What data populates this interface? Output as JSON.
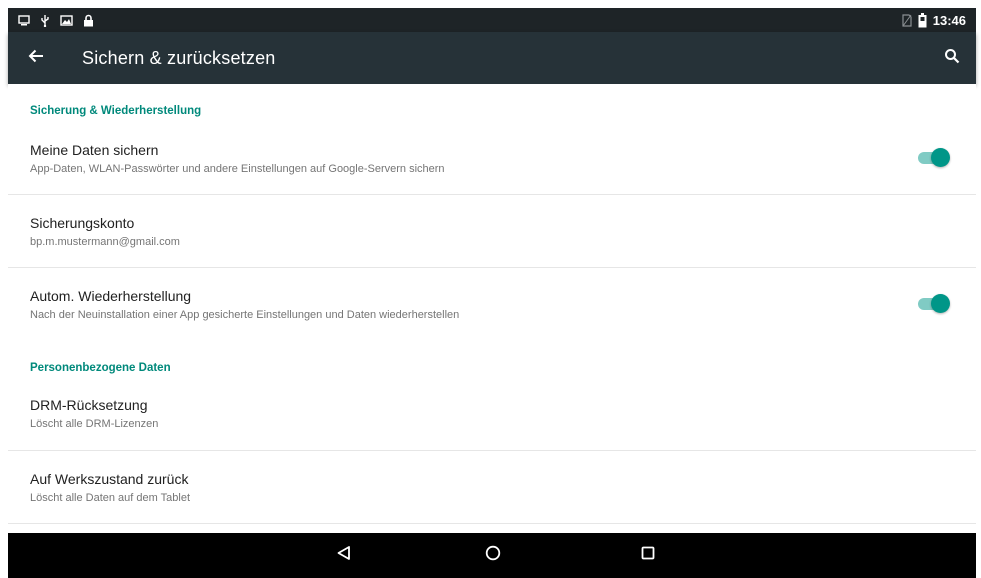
{
  "status_bar": {
    "time": "13:46",
    "icons_left": [
      "screen-icon",
      "usb-icon",
      "image-icon",
      "lock-icon"
    ],
    "icons_right": [
      "no-sim-icon",
      "battery-icon"
    ]
  },
  "toolbar": {
    "title": "Sichern & zurücksetzen",
    "back_icon": "arrow-back-icon",
    "search_icon": "search-icon"
  },
  "sections": [
    {
      "header": "Sicherung & Wiederherstellung",
      "items": [
        {
          "title": "Meine Daten sichern",
          "summary": "App-Daten, WLAN-Passwörter und andere Einstellungen auf Google-Servern sichern",
          "switch_on": true
        },
        {
          "title": "Sicherungskonto",
          "summary": "bp.m.mustermann@gmail.com"
        },
        {
          "title": "Autom. Wiederherstellung",
          "summary": "Nach der Neuinstallation einer App gesicherte Einstellungen und Daten wiederherstellen",
          "switch_on": true
        }
      ]
    },
    {
      "header": "Personenbezogene Daten",
      "items": [
        {
          "title": "DRM-Rücksetzung",
          "summary": "Löscht alle DRM-Lizenzen"
        },
        {
          "title": "Auf Werkszustand zurück",
          "summary": "Löscht alle Daten auf dem Tablet"
        }
      ]
    }
  ],
  "nav_bar": {
    "buttons": [
      "back-triangle-icon",
      "home-circle-icon",
      "recents-square-icon"
    ]
  },
  "colors": {
    "accent": "#009688",
    "section_header": "#00897b",
    "toolbar": "#263238",
    "status_bar": "#1e2427",
    "nav_bar": "#000000"
  }
}
